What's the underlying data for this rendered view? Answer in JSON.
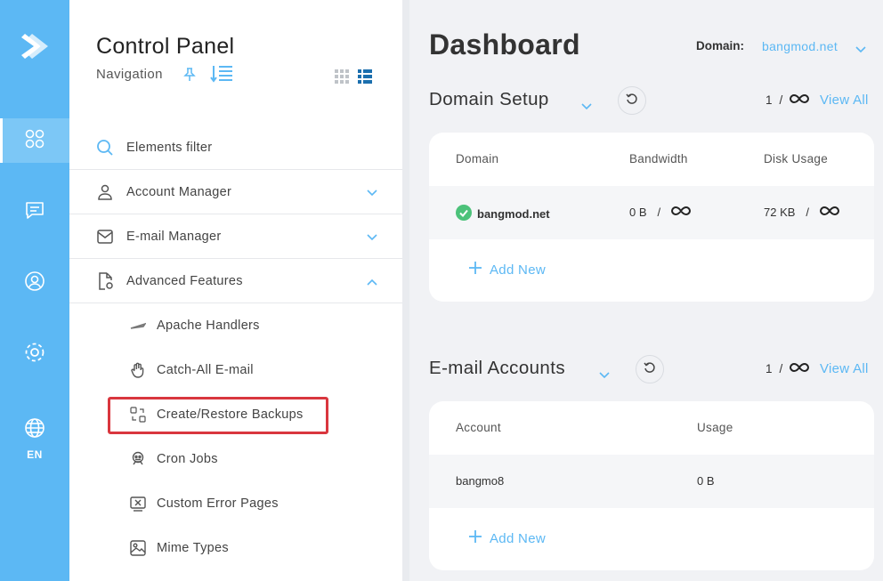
{
  "rail": {
    "language": "EN",
    "brand_color": "#5cb8f4"
  },
  "nav": {
    "title": "Control Panel",
    "subtitle": "Navigation",
    "filter_label": "Elements filter",
    "sections": [
      {
        "label": "Account Manager",
        "icon": "user-icon",
        "expanded": false
      },
      {
        "label": "E-mail Manager",
        "icon": "envelope-icon",
        "expanded": false
      },
      {
        "label": "Advanced Features",
        "icon": "file-gear-icon",
        "expanded": true
      }
    ],
    "sub_items": [
      {
        "label": "Apache Handlers",
        "icon": "feather-icon"
      },
      {
        "label": "Catch-All E-mail",
        "icon": "hand-icon"
      },
      {
        "label": "Create/Restore Backups",
        "icon": "backup-icon"
      },
      {
        "label": "Cron Jobs",
        "icon": "robot-icon"
      },
      {
        "label": "Custom Error Pages",
        "icon": "error-page-icon"
      },
      {
        "label": "Mime Types",
        "icon": "image-icon"
      }
    ]
  },
  "main": {
    "title": "Dashboard",
    "domain_label": "Domain:",
    "domain_value": "bangmod.net",
    "domain_setup": {
      "title": "Domain Setup",
      "count": "1",
      "separator": "/",
      "view_all": "View All",
      "columns": [
        "Domain",
        "Bandwidth",
        "Disk Usage"
      ],
      "row": {
        "domain": "bangmod.net",
        "bandwidth": "0 B",
        "bandwidth_sep": "/",
        "disk": "72 KB",
        "disk_sep": "/"
      },
      "add_new": "Add New"
    },
    "email_accounts": {
      "title": "E-mail Accounts",
      "count": "1",
      "separator": "/",
      "view_all": "View All",
      "columns": [
        "Account",
        "Usage"
      ],
      "row": {
        "account": "bangmo8",
        "usage": "0 B"
      },
      "add_new": "Add New"
    }
  }
}
